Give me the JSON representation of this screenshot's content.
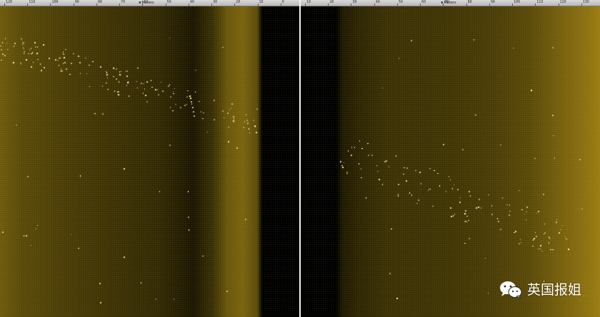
{
  "left_panel": {
    "ruler": {
      "unit_label": "Meters",
      "ticks": [
        "120",
        "110",
        "100",
        "90",
        "80",
        "70",
        "60",
        "50",
        "40",
        "30",
        "20",
        "10",
        "0"
      ]
    }
  },
  "right_panel": {
    "ruler": {
      "unit_label": "Meters",
      "ticks": [
        "10",
        "20",
        "30",
        "40",
        "50",
        "60",
        "70",
        "80",
        "90",
        "100",
        "110",
        "120",
        "130"
      ]
    }
  },
  "watermark": {
    "text": "英国报姐",
    "icon": "wechat-icon"
  },
  "colors": {
    "sonar_bright": "#9a7d14",
    "sonar_dark": "#1b1602",
    "water_column": "#000000",
    "divider": "#f2f2f2",
    "ruler": "#c9c9c9"
  }
}
